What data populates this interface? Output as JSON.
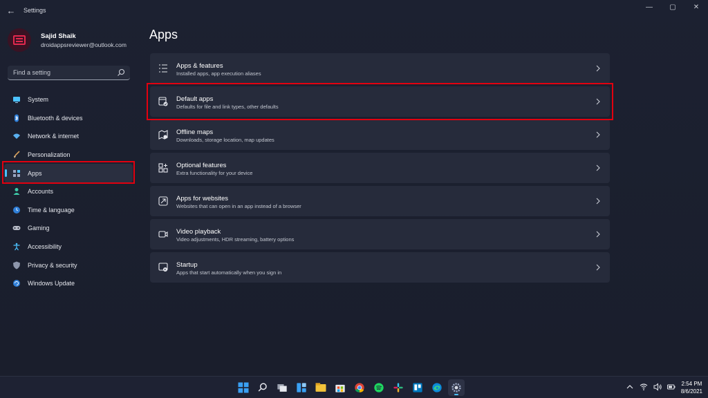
{
  "window": {
    "title": "Settings",
    "controls": {
      "minimize": "—",
      "maximize": "▢",
      "close": "✕"
    }
  },
  "profile": {
    "name": "Sajid Shaik",
    "email": "droidappsreviewer@outlook.com"
  },
  "search": {
    "placeholder": "Find a setting"
  },
  "sidebar": {
    "items": [
      {
        "label": "System",
        "icon": "monitor-icon",
        "active": false
      },
      {
        "label": "Bluetooth & devices",
        "icon": "bluetooth-icon",
        "active": false
      },
      {
        "label": "Network & internet",
        "icon": "wifi-icon",
        "active": false
      },
      {
        "label": "Personalization",
        "icon": "brush-icon",
        "active": false
      },
      {
        "label": "Apps",
        "icon": "apps-icon",
        "active": true
      },
      {
        "label": "Accounts",
        "icon": "person-icon",
        "active": false
      },
      {
        "label": "Time & language",
        "icon": "globe-clock-icon",
        "active": false
      },
      {
        "label": "Gaming",
        "icon": "gamepad-icon",
        "active": false
      },
      {
        "label": "Accessibility",
        "icon": "accessibility-icon",
        "active": false
      },
      {
        "label": "Privacy & security",
        "icon": "shield-icon",
        "active": false
      },
      {
        "label": "Windows Update",
        "icon": "update-icon",
        "active": false
      }
    ]
  },
  "main": {
    "title": "Apps",
    "cards": [
      {
        "title": "Apps & features",
        "subtitle": "Installed apps, app execution aliases",
        "icon": "list-icon"
      },
      {
        "title": "Default apps",
        "subtitle": "Defaults for file and link types, other defaults",
        "icon": "default-apps-icon"
      },
      {
        "title": "Offline maps",
        "subtitle": "Downloads, storage location, map updates",
        "icon": "map-icon"
      },
      {
        "title": "Optional features",
        "subtitle": "Extra functionality for your device",
        "icon": "grid-plus-icon"
      },
      {
        "title": "Apps for websites",
        "subtitle": "Websites that can open in an app instead of a browser",
        "icon": "link-window-icon"
      },
      {
        "title": "Video playback",
        "subtitle": "Video adjustments, HDR streaming, battery options",
        "icon": "video-icon"
      },
      {
        "title": "Startup",
        "subtitle": "Apps that start automatically when you sign in",
        "icon": "startup-icon"
      }
    ]
  },
  "taskbar": {
    "apps": [
      "windows-start-icon",
      "search-icon",
      "task-view-icon",
      "widgets-icon",
      "file-explorer-icon",
      "store-icon",
      "chrome-icon",
      "spotify-icon",
      "slack-icon",
      "trello-icon",
      "edge-icon",
      "settings-icon"
    ],
    "tray": [
      "chevron-up-icon",
      "wifi-icon",
      "volume-icon",
      "battery-icon"
    ],
    "time": "2:54 PM",
    "date": "8/6/2021"
  },
  "colors": {
    "background": "#1c2131",
    "card": "#262b3b",
    "accent": "#4cc2ff",
    "highlight_box": "#e3000f"
  }
}
